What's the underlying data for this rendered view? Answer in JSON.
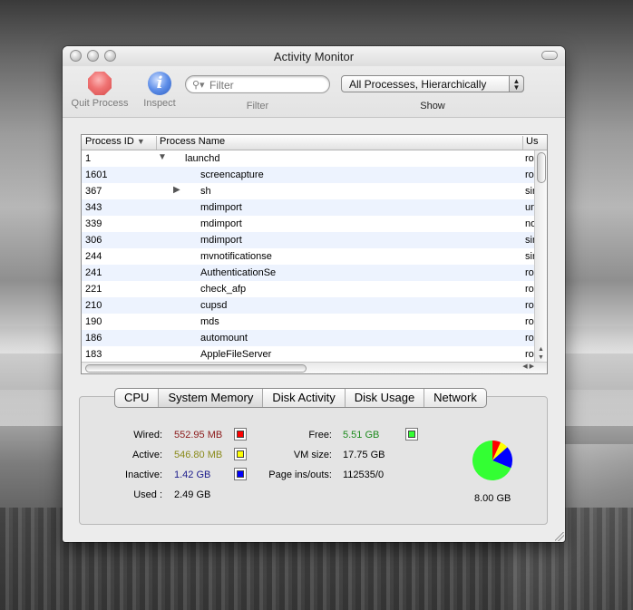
{
  "window": {
    "title": "Activity Monitor"
  },
  "toolbar": {
    "quit_label": "Quit Process",
    "inspect_label": "Inspect",
    "filter_placeholder": "Filter",
    "filter_label": "Filter",
    "show_value": "All Processes, Hierarchically",
    "show_label": "Show"
  },
  "table": {
    "columns": {
      "pid": "Process ID",
      "name": "Process Name",
      "user": "Us"
    },
    "sort_indicator": "▼",
    "rows": [
      {
        "pid": "1",
        "name": "launchd",
        "user": "ro",
        "disclosure": "▼"
      },
      {
        "pid": "1601",
        "name": "screencapture",
        "user": "ro"
      },
      {
        "pid": "367",
        "name": "sh",
        "user": "sir",
        "disclosure": "▶"
      },
      {
        "pid": "343",
        "name": "mdimport",
        "user": "un"
      },
      {
        "pid": "339",
        "name": "mdimport",
        "user": "no"
      },
      {
        "pid": "306",
        "name": "mdimport",
        "user": "sir"
      },
      {
        "pid": "244",
        "name": "mvnotificationse",
        "user": "sir"
      },
      {
        "pid": "241",
        "name": "AuthenticationSe",
        "user": "ro"
      },
      {
        "pid": "221",
        "name": "check_afp",
        "user": "ro"
      },
      {
        "pid": "210",
        "name": "cupsd",
        "user": "ro"
      },
      {
        "pid": "190",
        "name": "mds",
        "user": "ro"
      },
      {
        "pid": "186",
        "name": "automount",
        "user": "ro"
      },
      {
        "pid": "183",
        "name": "AppleFileServer",
        "user": "ro"
      }
    ]
  },
  "tabs": [
    "CPU",
    "System Memory",
    "Disk Activity",
    "Disk Usage",
    "Network"
  ],
  "selected_tab": "System Memory",
  "memory": {
    "wired_label": "Wired:",
    "wired_value": "552.95 MB",
    "wired_color": "#8b1a1a",
    "wired_swatch": "#ff0000",
    "active_label": "Active:",
    "active_value": "546.80 MB",
    "active_color": "#8a8a1a",
    "active_swatch": "#ffff00",
    "inactive_label": "Inactive:",
    "inactive_value": "1.42 GB",
    "inactive_color": "#1a1a8b",
    "inactive_swatch": "#0000ff",
    "used_label": "Used :",
    "used_value": "2.49 GB",
    "free_label": "Free:",
    "free_value": "5.51 GB",
    "free_color": "#1c8a1c",
    "free_swatch": "#33ff33",
    "vm_label": "VM size:",
    "vm_value": "17.75 GB",
    "pageins_label": "Page ins/outs:",
    "pageins_value": "112535/0",
    "total": "8.00 GB",
    "pie_fractions": {
      "wired": 0.0675,
      "active": 0.0667,
      "inactive": 0.1775,
      "free": 0.6888
    }
  }
}
